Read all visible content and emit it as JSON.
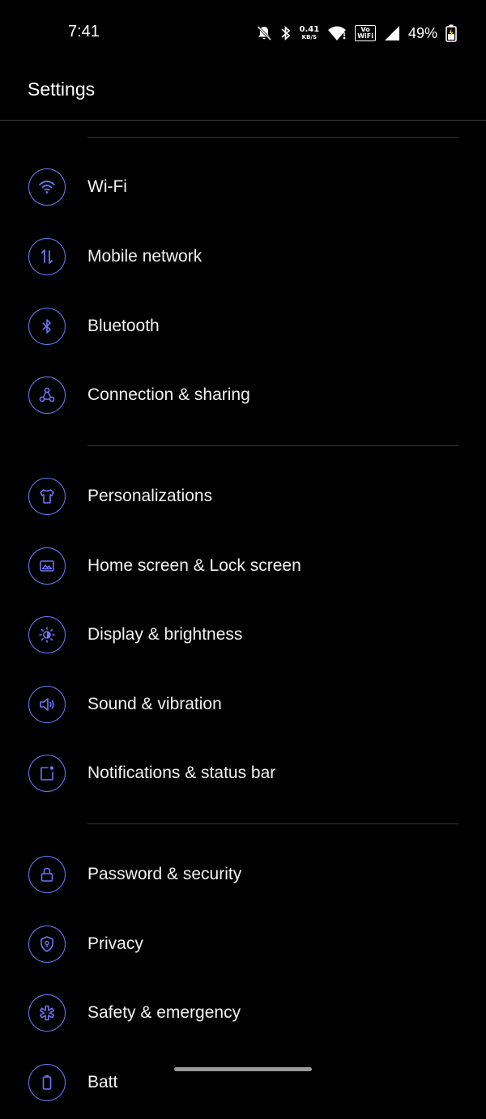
{
  "status_bar": {
    "time": "7:41",
    "net_speed_value": "0.41",
    "net_speed_unit": "KB/S",
    "vowifi_top": "Vo",
    "vowifi_bottom": "WiFi",
    "battery_percent": "49%",
    "icons": [
      "bell-off-icon",
      "bluetooth-icon",
      "wifi-icon",
      "signal-icon",
      "battery-charging-icon"
    ]
  },
  "header": {
    "title": "Settings"
  },
  "accent_color": "#6f74f5",
  "sections": [
    {
      "items": [
        {
          "label": "Wi-Fi",
          "icon": "wifi-icon"
        },
        {
          "label": "Mobile network",
          "icon": "mobile-data-icon"
        },
        {
          "label": "Bluetooth",
          "icon": "bluetooth-icon"
        },
        {
          "label": "Connection & sharing",
          "icon": "connection-sharing-icon"
        }
      ]
    },
    {
      "items": [
        {
          "label": "Personalizations",
          "icon": "shirt-icon"
        },
        {
          "label": "Home screen & Lock screen",
          "icon": "wallpaper-icon"
        },
        {
          "label": "Display & brightness",
          "icon": "brightness-icon"
        },
        {
          "label": "Sound & vibration",
          "icon": "speaker-icon"
        },
        {
          "label": "Notifications & status bar",
          "icon": "notification-icon"
        }
      ]
    },
    {
      "items": [
        {
          "label": "Password & security",
          "icon": "lock-icon"
        },
        {
          "label": "Privacy",
          "icon": "privacy-shield-icon"
        },
        {
          "label": "Safety & emergency",
          "icon": "emergency-icon"
        },
        {
          "label": "Batt",
          "icon": "battery-icon"
        }
      ]
    }
  ]
}
